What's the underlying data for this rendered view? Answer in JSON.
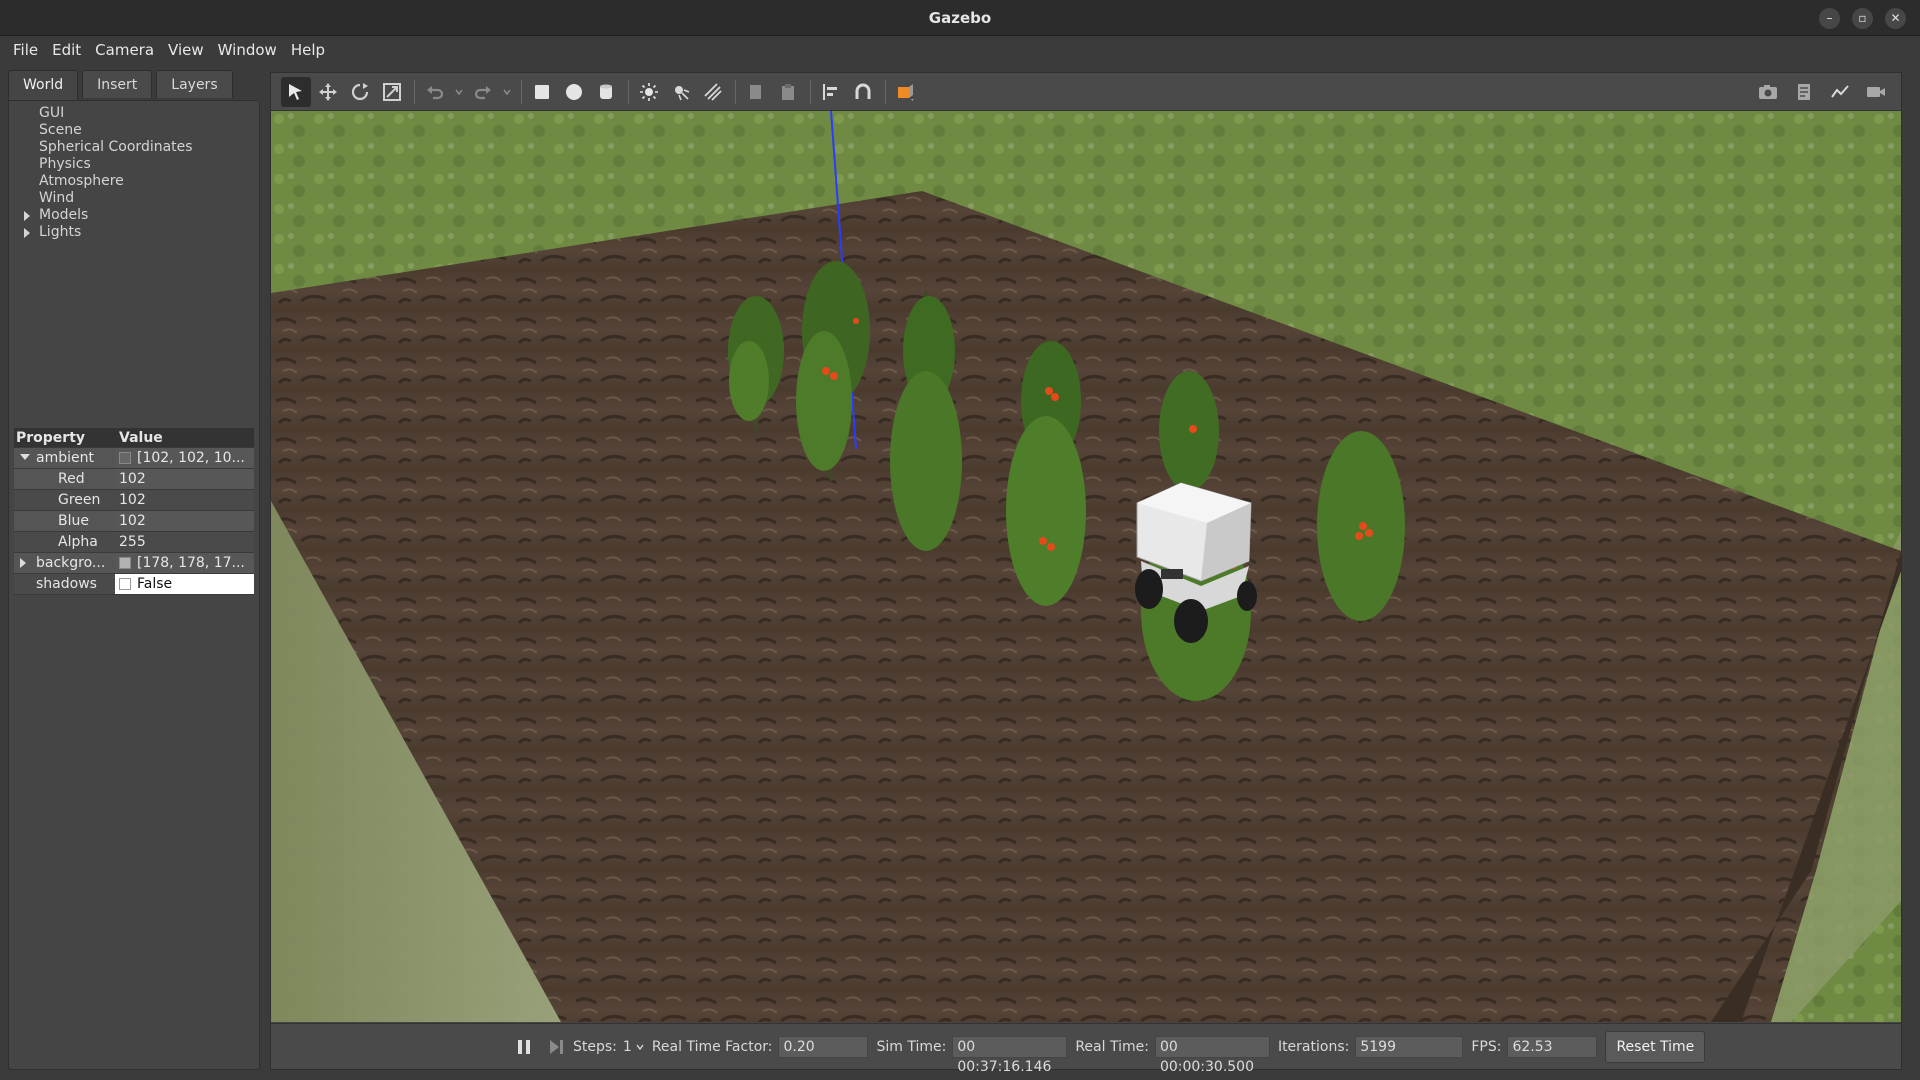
{
  "window": {
    "title": "Gazebo",
    "min": "–",
    "max": "▫",
    "close": "✕"
  },
  "menu": [
    "File",
    "Edit",
    "Camera",
    "View",
    "Window",
    "Help"
  ],
  "tabs": [
    "World",
    "Insert",
    "Layers"
  ],
  "world_tree": [
    {
      "label": "GUI",
      "expandable": false
    },
    {
      "label": "Scene",
      "expandable": false
    },
    {
      "label": "Spherical Coordinates",
      "expandable": false
    },
    {
      "label": "Physics",
      "expandable": false
    },
    {
      "label": "Atmosphere",
      "expandable": false
    },
    {
      "label": "Wind",
      "expandable": false
    },
    {
      "label": "Models",
      "expandable": true
    },
    {
      "label": "Lights",
      "expandable": true
    }
  ],
  "properties": {
    "header_property": "Property",
    "header_value": "Value",
    "ambient": {
      "name": "ambient",
      "value": "[102, 102, 10...",
      "color": "#666666"
    },
    "red": {
      "name": "Red",
      "value": "102"
    },
    "green": {
      "name": "Green",
      "value": "102"
    },
    "blue": {
      "name": "Blue",
      "value": "102"
    },
    "alpha": {
      "name": "Alpha",
      "value": "255"
    },
    "background": {
      "name": "backgro...",
      "value": "[178, 178, 17...",
      "color": "#b2b2b2"
    },
    "shadows": {
      "name": "shadows",
      "value": "False"
    }
  },
  "status": {
    "steps_label": "Steps:",
    "steps_value": "1",
    "rtf_label": "Real Time Factor:",
    "rtf_value": "0.20",
    "sim_time_label": "Sim Time:",
    "sim_time_value": "00 00:37:16.146",
    "real_time_label": "Real Time:",
    "real_time_value": "00 00:00:30.500",
    "iterations_label": "Iterations:",
    "iterations_value": "5199",
    "fps_label": "FPS:",
    "fps_value": "62.53",
    "reset_label": "Reset Time"
  },
  "colors": {
    "accent_orange": "#f08a24",
    "axis_blue": "#2a3cff",
    "soil": "#4b3a2e",
    "grass": "#6d8a3e"
  }
}
